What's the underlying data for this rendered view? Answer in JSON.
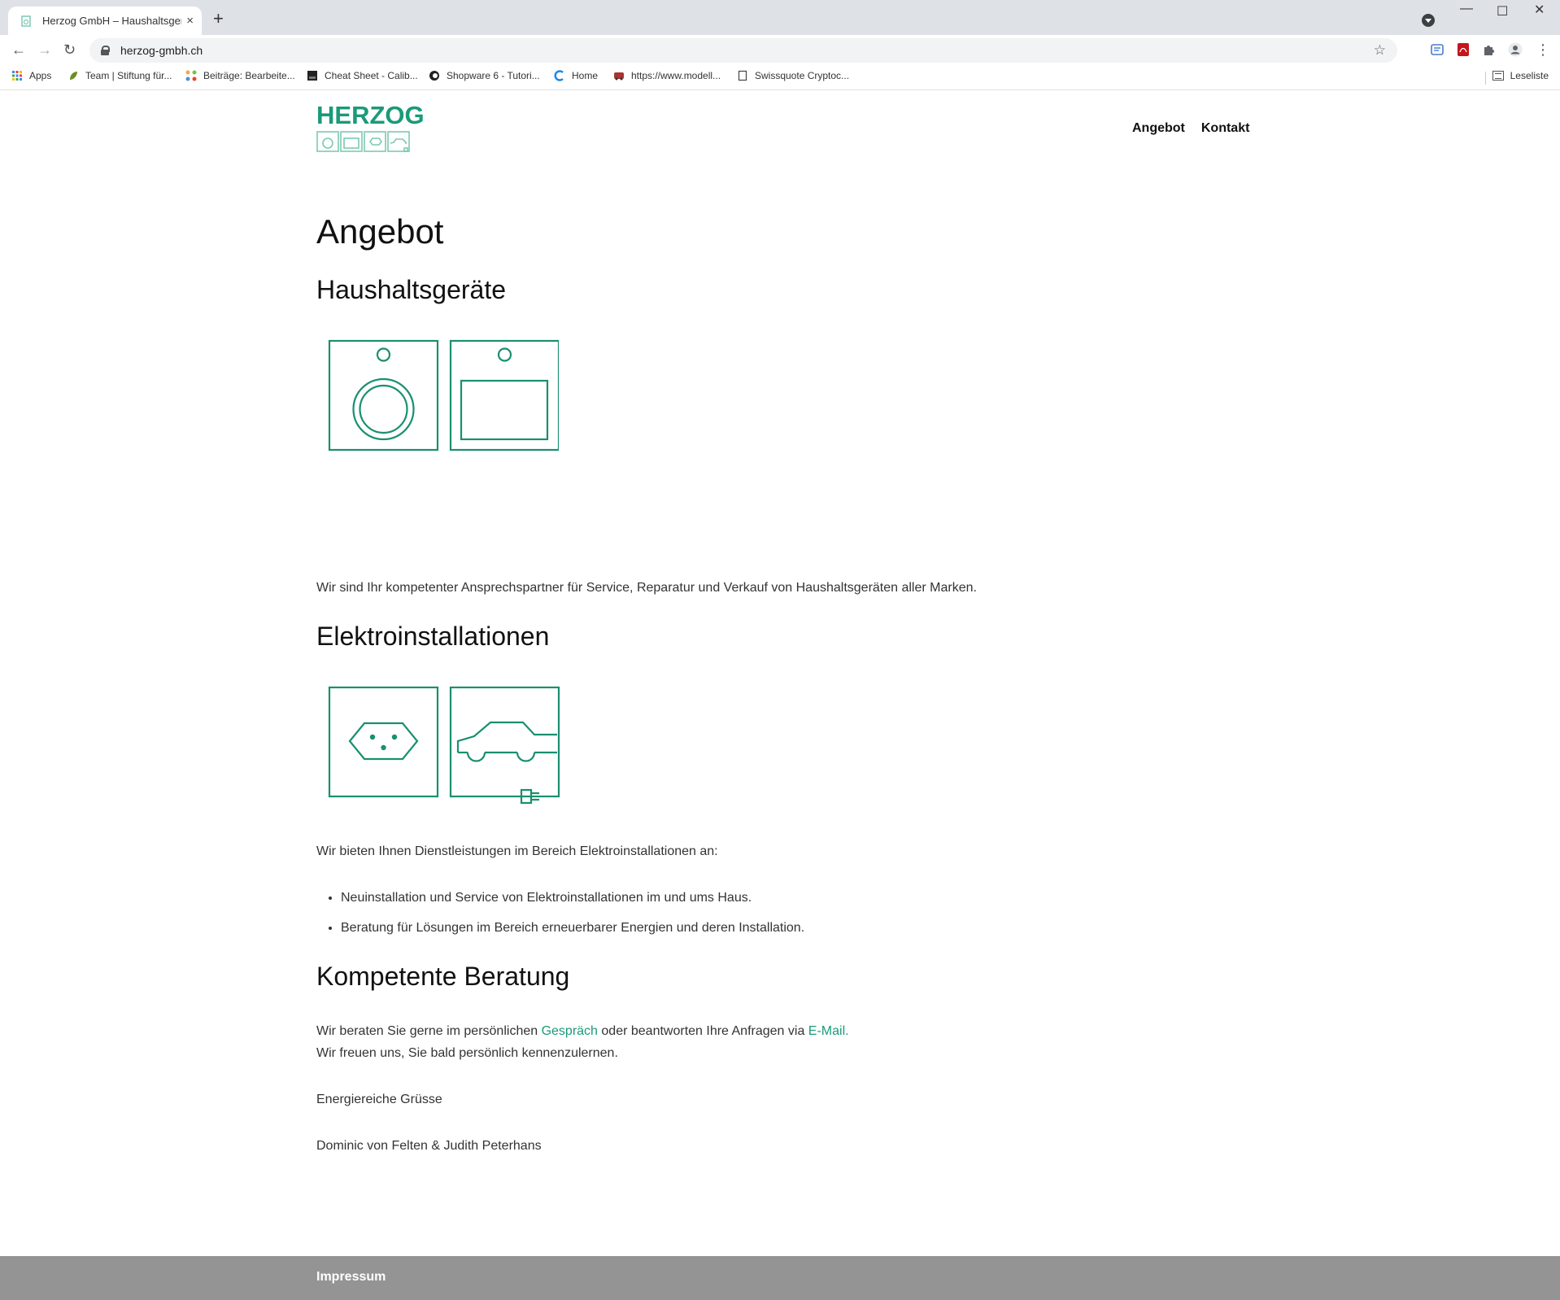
{
  "browser": {
    "tab_title": "Herzog GmbH – Haushaltsgeräte",
    "tab_close": "×",
    "new_tab": "+",
    "url": "herzog-gmbh.ch",
    "bookmarks": [
      {
        "label": "Apps"
      },
      {
        "label": "Team | Stiftung für..."
      },
      {
        "label": "Beiträge: Bearbeite..."
      },
      {
        "label": "Cheat Sheet - Calib..."
      },
      {
        "label": "Shopware 6 - Tutori..."
      },
      {
        "label": "Home"
      },
      {
        "label": "https://www.modell..."
      },
      {
        "label": "Swissquote Cryptoc..."
      }
    ],
    "reading_list": "Leseliste"
  },
  "site": {
    "logo_text": "HERZOG",
    "nav": [
      "Angebot",
      "Kontakt"
    ],
    "page_title": "Angebot",
    "section1": {
      "heading": "Haushaltsgeräte",
      "text": "Wir sind Ihr kompetenter Ansprechspartner für Service, Reparatur und Verkauf von Haushaltsgeräten aller Marken."
    },
    "section2": {
      "heading": "Elektroinstallationen",
      "intro": "Wir bieten Ihnen Dienstleistungen im Bereich Elektroinstallationen an:",
      "items": [
        "Neuinstallation und Service von Elektroinstallationen im und ums Haus.",
        "Beratung für Lösungen im Bereich erneuerbarer Energien und deren Installation."
      ]
    },
    "section3": {
      "heading": "Kompetente Beratung",
      "line1_a": "Wir beraten Sie gerne im persönlichen ",
      "line1_link1": "Gespräch",
      "line1_b": " oder beantworten Ihre Anfragen via ",
      "line1_link2": "E-Mail",
      "line1_c": ".",
      "line2": "Wir freuen uns, Sie bald persönlich kennenzulernen.",
      "greeting": "Energiereiche Grüsse",
      "signature": "Dominic von Felten & Judith Peterhans"
    },
    "footer_link": "Impressum"
  },
  "colors": {
    "brand_green": "#1a9a79",
    "footer_gray": "#949494"
  }
}
